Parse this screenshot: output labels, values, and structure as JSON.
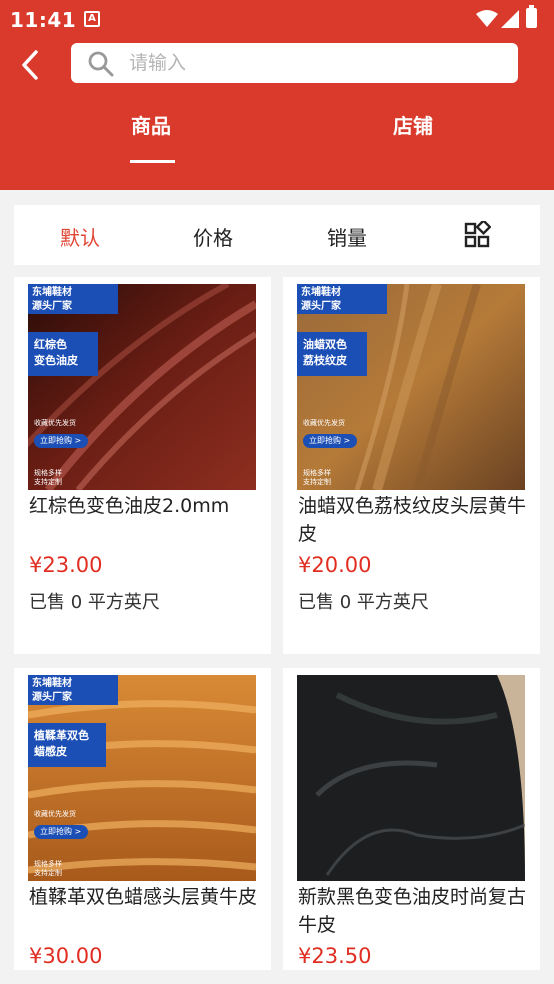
{
  "status": {
    "time": "11:41",
    "badge": "A"
  },
  "search": {
    "placeholder": "请输入"
  },
  "tabs": [
    {
      "label": "商品"
    },
    {
      "label": "店铺"
    }
  ],
  "sort": {
    "default": "默认",
    "price": "价格",
    "sales": "销量"
  },
  "products": [
    {
      "title": "红棕色变色油皮2.0mm",
      "price": "¥23.00",
      "sold_prefix": "已售",
      "sold_count": "0",
      "unit": "平方英尺",
      "image": {
        "top_text": "东埔鞋材\n源头厂家",
        "badge_text": "红棕色\n变色油皮",
        "pill": "立即抢购 >",
        "fine_1": "收藏优先发货",
        "fine_2": "规格多样\n支持定制"
      }
    },
    {
      "title": "油蜡双色荔枝纹皮头层黄牛皮",
      "price": "¥20.00",
      "sold_prefix": "已售",
      "sold_count": "0",
      "unit": "平方英尺",
      "image": {
        "top_text": "东埔鞋材\n源头厂家",
        "badge_text": "油蜡双色\n荔枝纹皮",
        "pill": "立即抢购 >",
        "fine_1": "收藏优先发货",
        "fine_2": "规格多样\n支持定制"
      }
    },
    {
      "title": "植鞣革双色蜡感头层黄牛皮",
      "price": "¥30.00",
      "image": {
        "top_text": "东埔鞋材\n源头厂家",
        "badge_text": "植鞣革双色\n蜡感皮",
        "pill": "立即抢购 >",
        "fine_1": "收藏优先发货",
        "fine_2": "规格多样\n支持定制"
      }
    },
    {
      "title": "新款黑色变色油皮时尚复古牛皮",
      "price": "¥23.50"
    }
  ],
  "colors": {
    "brand_red": "#d93a2b",
    "price_red": "#e02f22",
    "active_sort": "#e04634",
    "badge_blue": "#1c4fb5"
  }
}
